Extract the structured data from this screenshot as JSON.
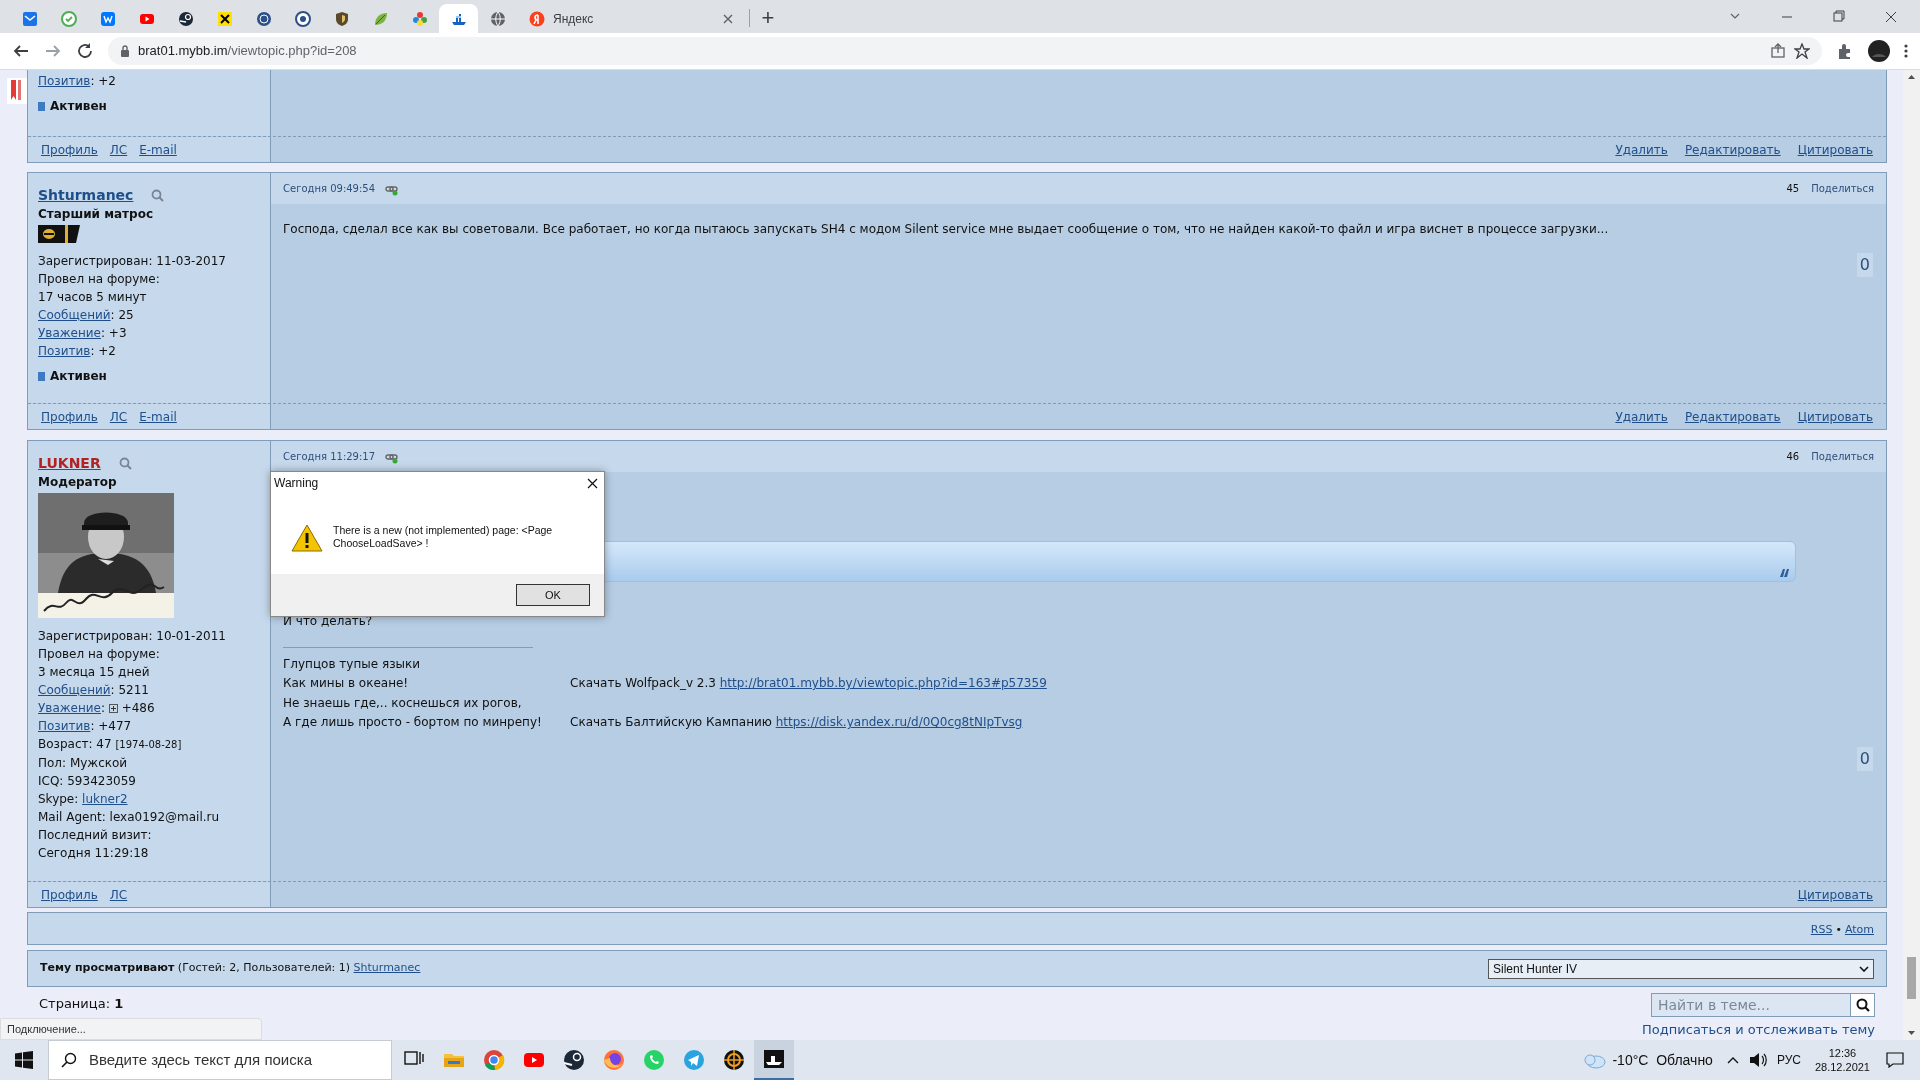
{
  "browser": {
    "tabs": [
      {
        "selected": false
      },
      {
        "selected": false
      },
      {
        "selected": false
      },
      {
        "selected": false
      },
      {
        "selected": false
      },
      {
        "selected": false
      },
      {
        "selected": false
      },
      {
        "selected": false
      },
      {
        "selected": false
      },
      {
        "selected": false
      },
      {
        "selected": false
      },
      {
        "selected": true
      },
      {
        "selected": false
      },
      {
        "selected": false,
        "title": "Яндекс"
      }
    ],
    "new_tab": "+",
    "url_host": "brat01.mybb.im",
    "url_path": "/viewtopic.php?id=208"
  },
  "posts": [
    {
      "info": [
        {
          "link": "Позитив",
          "after": ": +2"
        }
      ],
      "status": {
        "label": "Активен",
        "online": true
      },
      "profile_links": [
        "Профиль",
        "ЛС",
        "E-mail"
      ],
      "actions": [
        "Удалить",
        "Редактировать",
        "Цитировать"
      ]
    },
    {
      "author": {
        "name": "Shturmanec",
        "color": "#1f4f8a"
      },
      "rank": "Старший матрос",
      "insignia": true,
      "info": [
        {
          "before": "Зарегистрирован: 11-03-2017"
        },
        {
          "before": "Провел на форуме:"
        },
        {
          "before": "17 часов 5 минут"
        },
        {
          "link": "Сообщений",
          "after": ": 25"
        },
        {
          "link": "Уважение",
          "after": ": +3"
        },
        {
          "link": "Позитив",
          "after": ": +2"
        }
      ],
      "status": {
        "label": "Активен",
        "online": true
      },
      "time": "Сегодня 09:49:54",
      "number": "45",
      "share": "Поделиться",
      "body": [
        {
          "kind": "text",
          "text": "Господа, сделал все как вы советовали. Все работает, но когда пытаюсь запускать SH4 с модом Silent service мне выдает сообщение о том, что не найден какой-то файл и  игра виснет в процессе загрузки..."
        }
      ],
      "rating": "0",
      "profile_links": [
        "Профиль",
        "ЛС",
        "E-mail"
      ],
      "actions": [
        "Удалить",
        "Редактировать",
        "Цитировать"
      ]
    },
    {
      "author": {
        "name": "LUKNER",
        "color": "#b22222"
      },
      "rank": "Модератор",
      "avatar": true,
      "info": [
        {
          "before": "Зарегистрирован: 10-01-2011"
        },
        {
          "before": "Провел на форуме:"
        },
        {
          "before": "3 месяца 15 дней"
        },
        {
          "link": "Сообщений",
          "after": ": 5211"
        },
        {
          "link": "Уважение",
          "after": ": ",
          "plus_box": true,
          "tail": " +486"
        },
        {
          "link": "Позитив",
          "after": ": +477"
        },
        {
          "before": "Возраст: 47 ",
          "small": "[1974-08-28]"
        },
        {
          "before": "Пол: Мужской"
        },
        {
          "before": "ICQ: 593423059"
        },
        {
          "before": "Skype: ",
          "link": "lukner2"
        },
        {
          "before": "Mail Agent: lexa0192@mail.ru"
        },
        {
          "before": "Последний визит:"
        },
        {
          "before": "Сегодня 11:29:18"
        }
      ],
      "time": "Сегодня 11:29:17",
      "number": "46",
      "share": "Поделиться",
      "body": [
        {
          "kind": "quote"
        },
        {
          "kind": "text",
          "text": "И что делать?"
        },
        {
          "kind": "signature",
          "lines": [
            {
              "text": "Глупцов тупые языки"
            },
            {
              "text": "Как мины в океане!",
              "download": "Скачать Wolfpack_v 2.3",
              "link": "http://brat01.mybb.by/viewtopic.php?id=163#p57359"
            },
            {
              "text": "Не знаешь где,..  коснешься их рогов,"
            },
            {
              "text": "А где лишь просто - бортом по минрепу!",
              "download": "Скачать Балтийскую Кампанию",
              "link": "https://disk.yandex.ru/d/0Q0cg8tNIpTvsg"
            }
          ]
        }
      ],
      "rating": "0",
      "profile_links": [
        "Профиль",
        "ЛС"
      ],
      "actions": [
        "Цитировать"
      ]
    }
  ],
  "feeds": [
    "RSS",
    "•",
    "Atom"
  ],
  "viewers": {
    "label": "Тему просматривают",
    "counts": "(Гостей: 2, Пользователей: 1)",
    "users": [
      "Shturmanec"
    ]
  },
  "forum_select": "Silent Hunter IV",
  "pages": {
    "label": "Страница:",
    "current": "1"
  },
  "search": {
    "placeholder": "Найти в теме..."
  },
  "subscribe": "Подписаться и отслеживать тему",
  "browser_status": "Подключение...",
  "dialog": {
    "title": "Warning",
    "message": "There is a new (not implemented) page: <Page ChooseLoadSave> !",
    "button": "OK"
  },
  "taskbar": {
    "search_placeholder": "Введите здесь текст для поиска",
    "weather": "-10°C  Облачно",
    "language": "РУС",
    "time": "12:36",
    "date": "28.12.2021"
  }
}
